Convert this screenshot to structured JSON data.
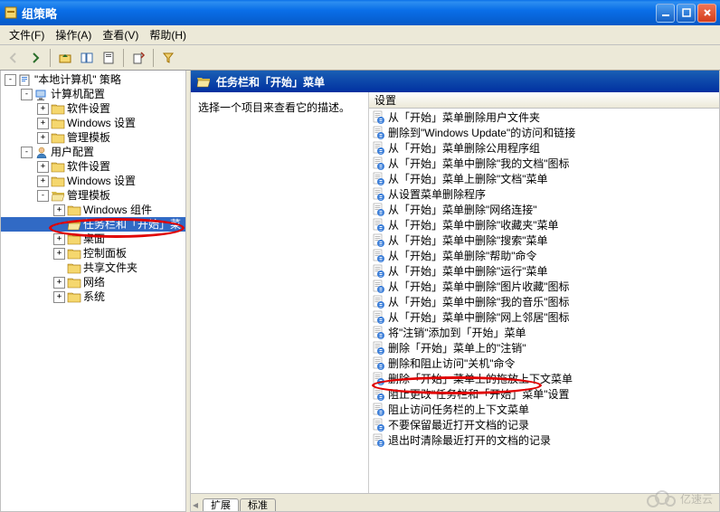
{
  "window": {
    "title": "组策略"
  },
  "menu": {
    "file": "文件(F)",
    "action": "操作(A)",
    "view": "查看(V)",
    "help": "帮助(H)"
  },
  "tree": {
    "root": "\"本地计算机\" 策略",
    "computer_config": "计算机配置",
    "software_settings": "软件设置",
    "windows_settings": "Windows 设置",
    "admin_templates": "管理模板",
    "user_config": "用户配置",
    "windows_components": "Windows 组件",
    "taskbar_start": "任务栏和「开始」菜",
    "desktop": "桌面",
    "control_panel": "控制面板",
    "shared_folders": "共享文件夹",
    "network": "网络",
    "system": "系统"
  },
  "detail": {
    "header_title": "任务栏和「开始」菜单",
    "description_prompt": "选择一个项目来查看它的描述。",
    "col_setting": "设置",
    "tabs": {
      "extended": "扩展",
      "standard": "标准"
    }
  },
  "policies": [
    "从「开始」菜单删除用户文件夹",
    "删除到\"Windows Update\"的访问和链接",
    "从「开始」菜单删除公用程序组",
    "从「开始」菜单中删除\"我的文档\"图标",
    "从「开始」菜单上删除\"文档\"菜单",
    "从设置菜单删除程序",
    "从「开始」菜单删除\"网络连接\"",
    "从「开始」菜单中删除\"收藏夹\"菜单",
    "从「开始」菜单中删除\"搜索\"菜单",
    "从「开始」菜单删除\"帮助\"命令",
    "从「开始」菜单中删除\"运行\"菜单",
    "从「开始」菜单中删除\"图片收藏\"图标",
    "从「开始」菜单中删除\"我的音乐\"图标",
    "从「开始」菜单中删除\"网上邻居\"图标",
    "将\"注销\"添加到「开始」菜单",
    "删除「开始」菜单上的\"注销\"",
    "删除和阻止访问\"关机\"命令",
    "删除「开始」菜单上的拖放上下文菜单",
    "阻止更改\"任务栏和「开始」菜单\"设置",
    "阻止访问任务栏的上下文菜单",
    "不要保留最近打开文档的记录",
    "退出时清除最近打开的文档的记录"
  ],
  "icons": {
    "folder_closed_fill": "#f5d76e",
    "folder_open_fill": "#f5e6a0",
    "policy_accent": "#3a7dd8"
  },
  "watermark": "亿速云"
}
